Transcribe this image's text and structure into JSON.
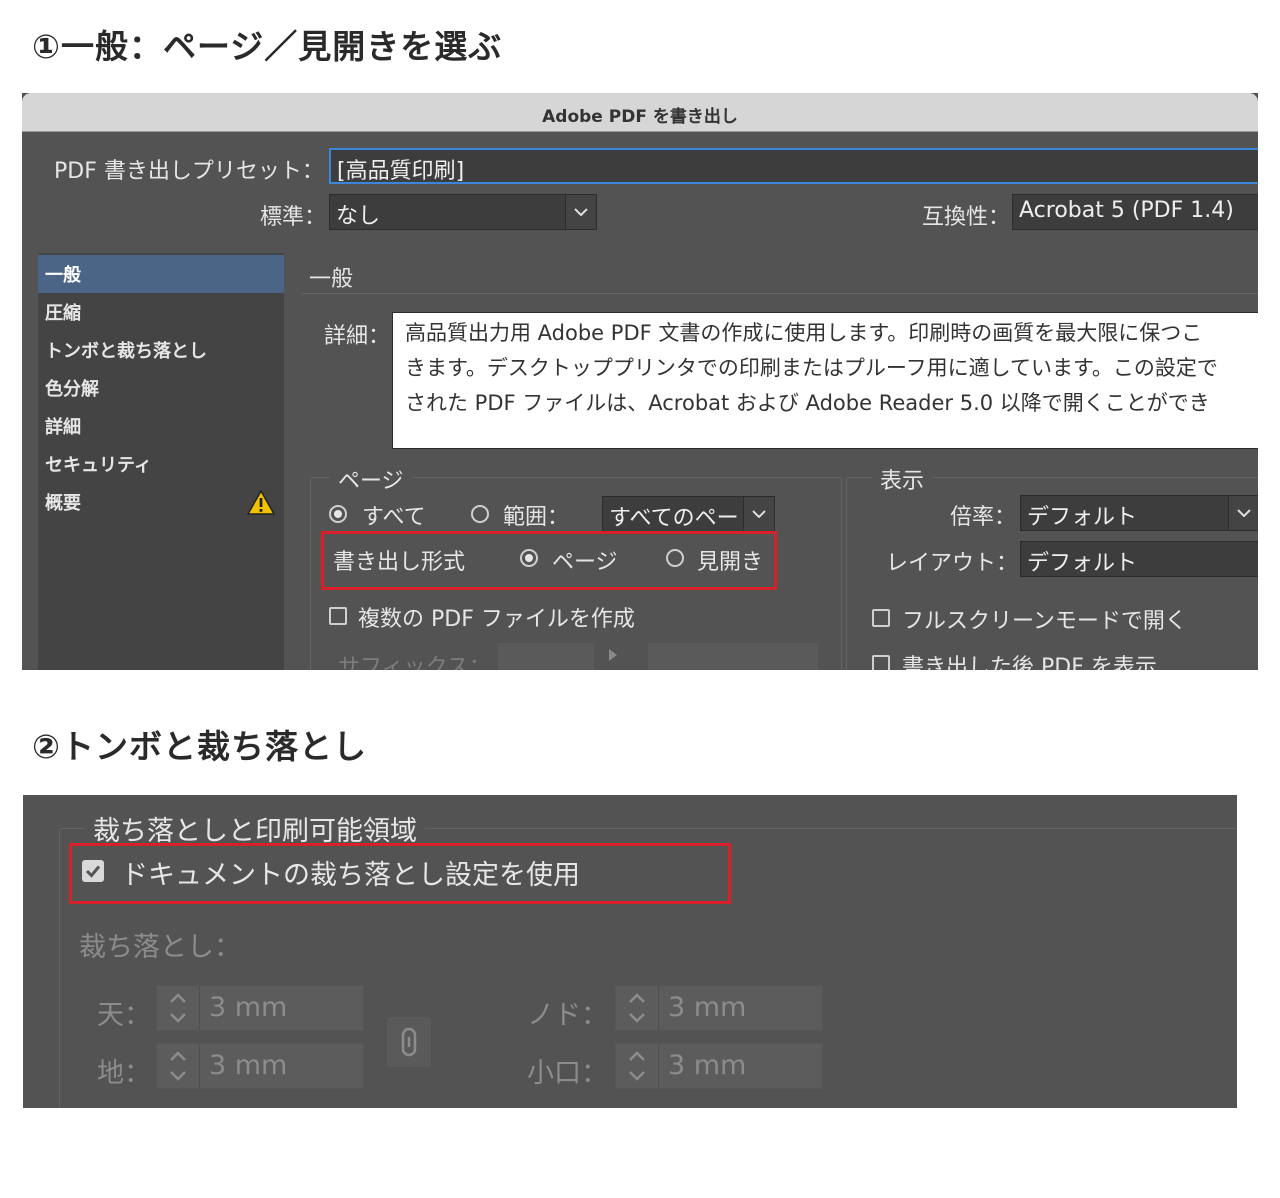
{
  "headings": {
    "step1": "①一般：ページ／見開きを選ぶ",
    "step2": "②トンボと裁ち落とし"
  },
  "dialog": {
    "title": "Adobe PDF を書き出し",
    "preset_label": "PDF 書き出しプリセット：",
    "preset_value": "[高品質印刷]",
    "standard_label": "標準：",
    "standard_value": "なし",
    "compat_label": "互換性：",
    "compat_value": "Acrobat 5 (PDF 1.4)",
    "sidebar": [
      "一般",
      "圧縮",
      "トンボと裁ち落とし",
      "色分解",
      "詳細",
      "セキュリティ",
      "概要"
    ],
    "section_title": "一般",
    "desc_label": "詳細：",
    "desc_lines": [
      "高品質出力用 Adobe PDF 文書の作成に使用します。印刷時の画質を最大限に保つこ",
      "きます。デスクトッププリンタでの印刷またはプルーフ用に適しています。この設定で",
      "された PDF ファイルは、Acrobat および Adobe Reader 5.0 以降で開くことができ"
    ],
    "pages_group": "ページ",
    "radio_all": "すべて",
    "radio_range": "範囲：",
    "range_value": "すべてのペー",
    "export_format_label": "書き出し形式",
    "format_page": "ページ",
    "format_spread": "見開き",
    "multi_pdf": "複数の PDF ファイルを作成",
    "suffix_label": "サフィックス：",
    "view_group": "表示",
    "zoom_label": "倍率：",
    "zoom_value": "デフォルト",
    "layout_label": "レイアウト：",
    "layout_value": "デフォルト",
    "fullscreen": "フルスクリーンモードで開く",
    "view_after": "書き出した後 PDF を表示"
  },
  "bleed_panel": {
    "group_title": "裁ち落としと印刷可能領域",
    "use_doc_bleed": "ドキュメントの裁ち落とし設定を使用",
    "use_doc_bleed_checked": true,
    "bleed_label": "裁ち落とし：",
    "top_label": "天：",
    "top_value": "3 mm",
    "bottom_label": "地：",
    "bottom_value": "3 mm",
    "inside_label": "ノド：",
    "inside_value": "3 mm",
    "outside_label": "小口：",
    "outside_value": "3 mm"
  },
  "colors": {
    "highlight": "#d8202a",
    "panel": "#535353",
    "selection": "#4a6585"
  },
  "icons": [
    "warning-icon",
    "chevron-down-icon",
    "link-icon",
    "stepper-icon",
    "checkmark-icon"
  ]
}
